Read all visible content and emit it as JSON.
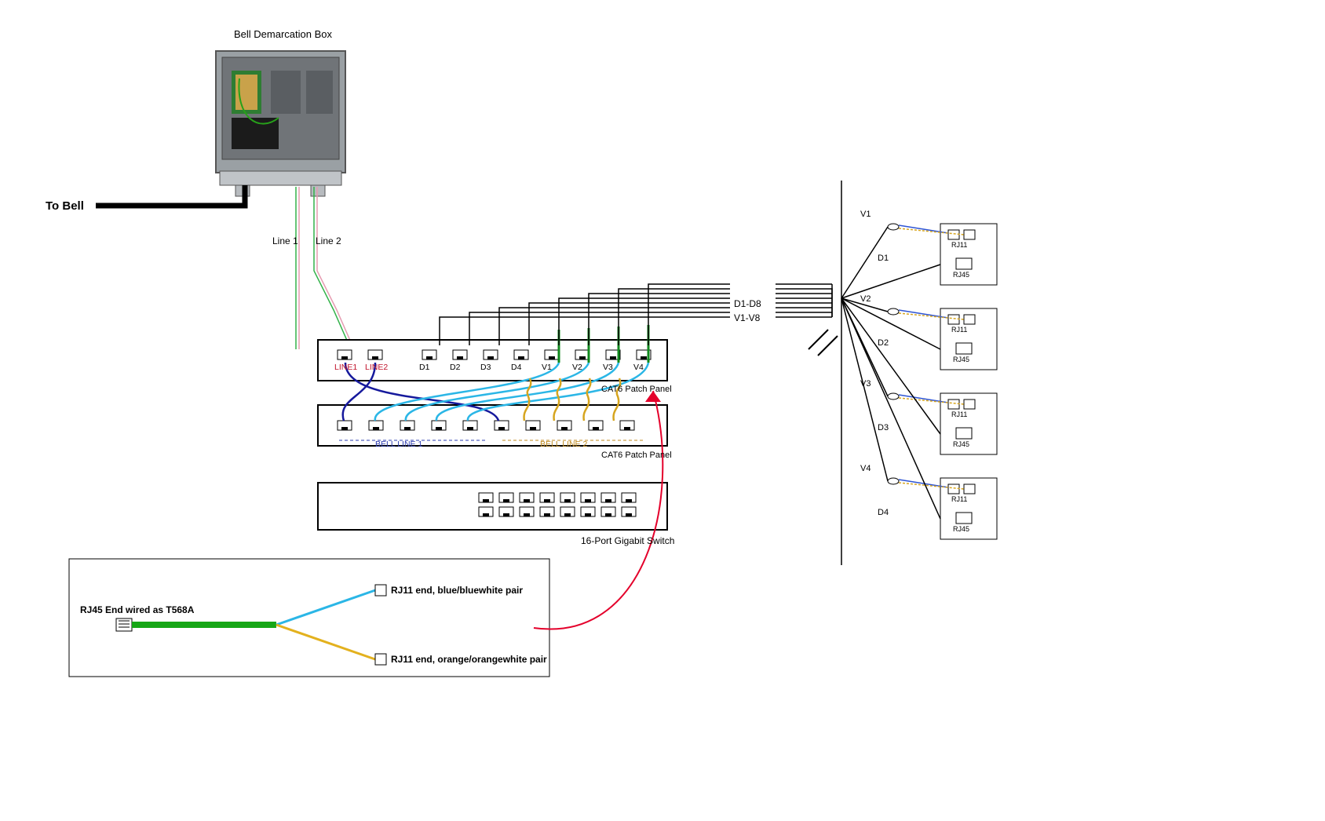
{
  "title": "Bell Demarcation Box",
  "to_bell": "To Bell",
  "line1": "Line 1",
  "line2": "Line 2",
  "panel1": {
    "label": "CAT6 Patch Panel",
    "ports": [
      "LINE1",
      "LINE2",
      "D1",
      "D2",
      "D3",
      "D4",
      "V1",
      "V2",
      "V3",
      "V4"
    ]
  },
  "panel2": {
    "label": "CAT6 Patch Panel",
    "bell1": "BELL LINE 1",
    "bell2": "BELL LINE 2"
  },
  "switch": {
    "label": "16-Port Gigabit Switch"
  },
  "busD": "D1-D8",
  "busV": "V1-V8",
  "legend": {
    "rj45": "RJ45 End wired as T568A",
    "rj11a": "RJ11 end, blue/bluewhite pair",
    "rj11b": "RJ11 end, orange/orangewhite pair"
  },
  "wall": [
    {
      "v": "V1",
      "d": "D1"
    },
    {
      "v": "V2",
      "d": "D2"
    },
    {
      "v": "V3",
      "d": "D3"
    },
    {
      "v": "V4",
      "d": "D4"
    }
  ],
  "rj11": "RJ11",
  "rj45": "RJ45"
}
